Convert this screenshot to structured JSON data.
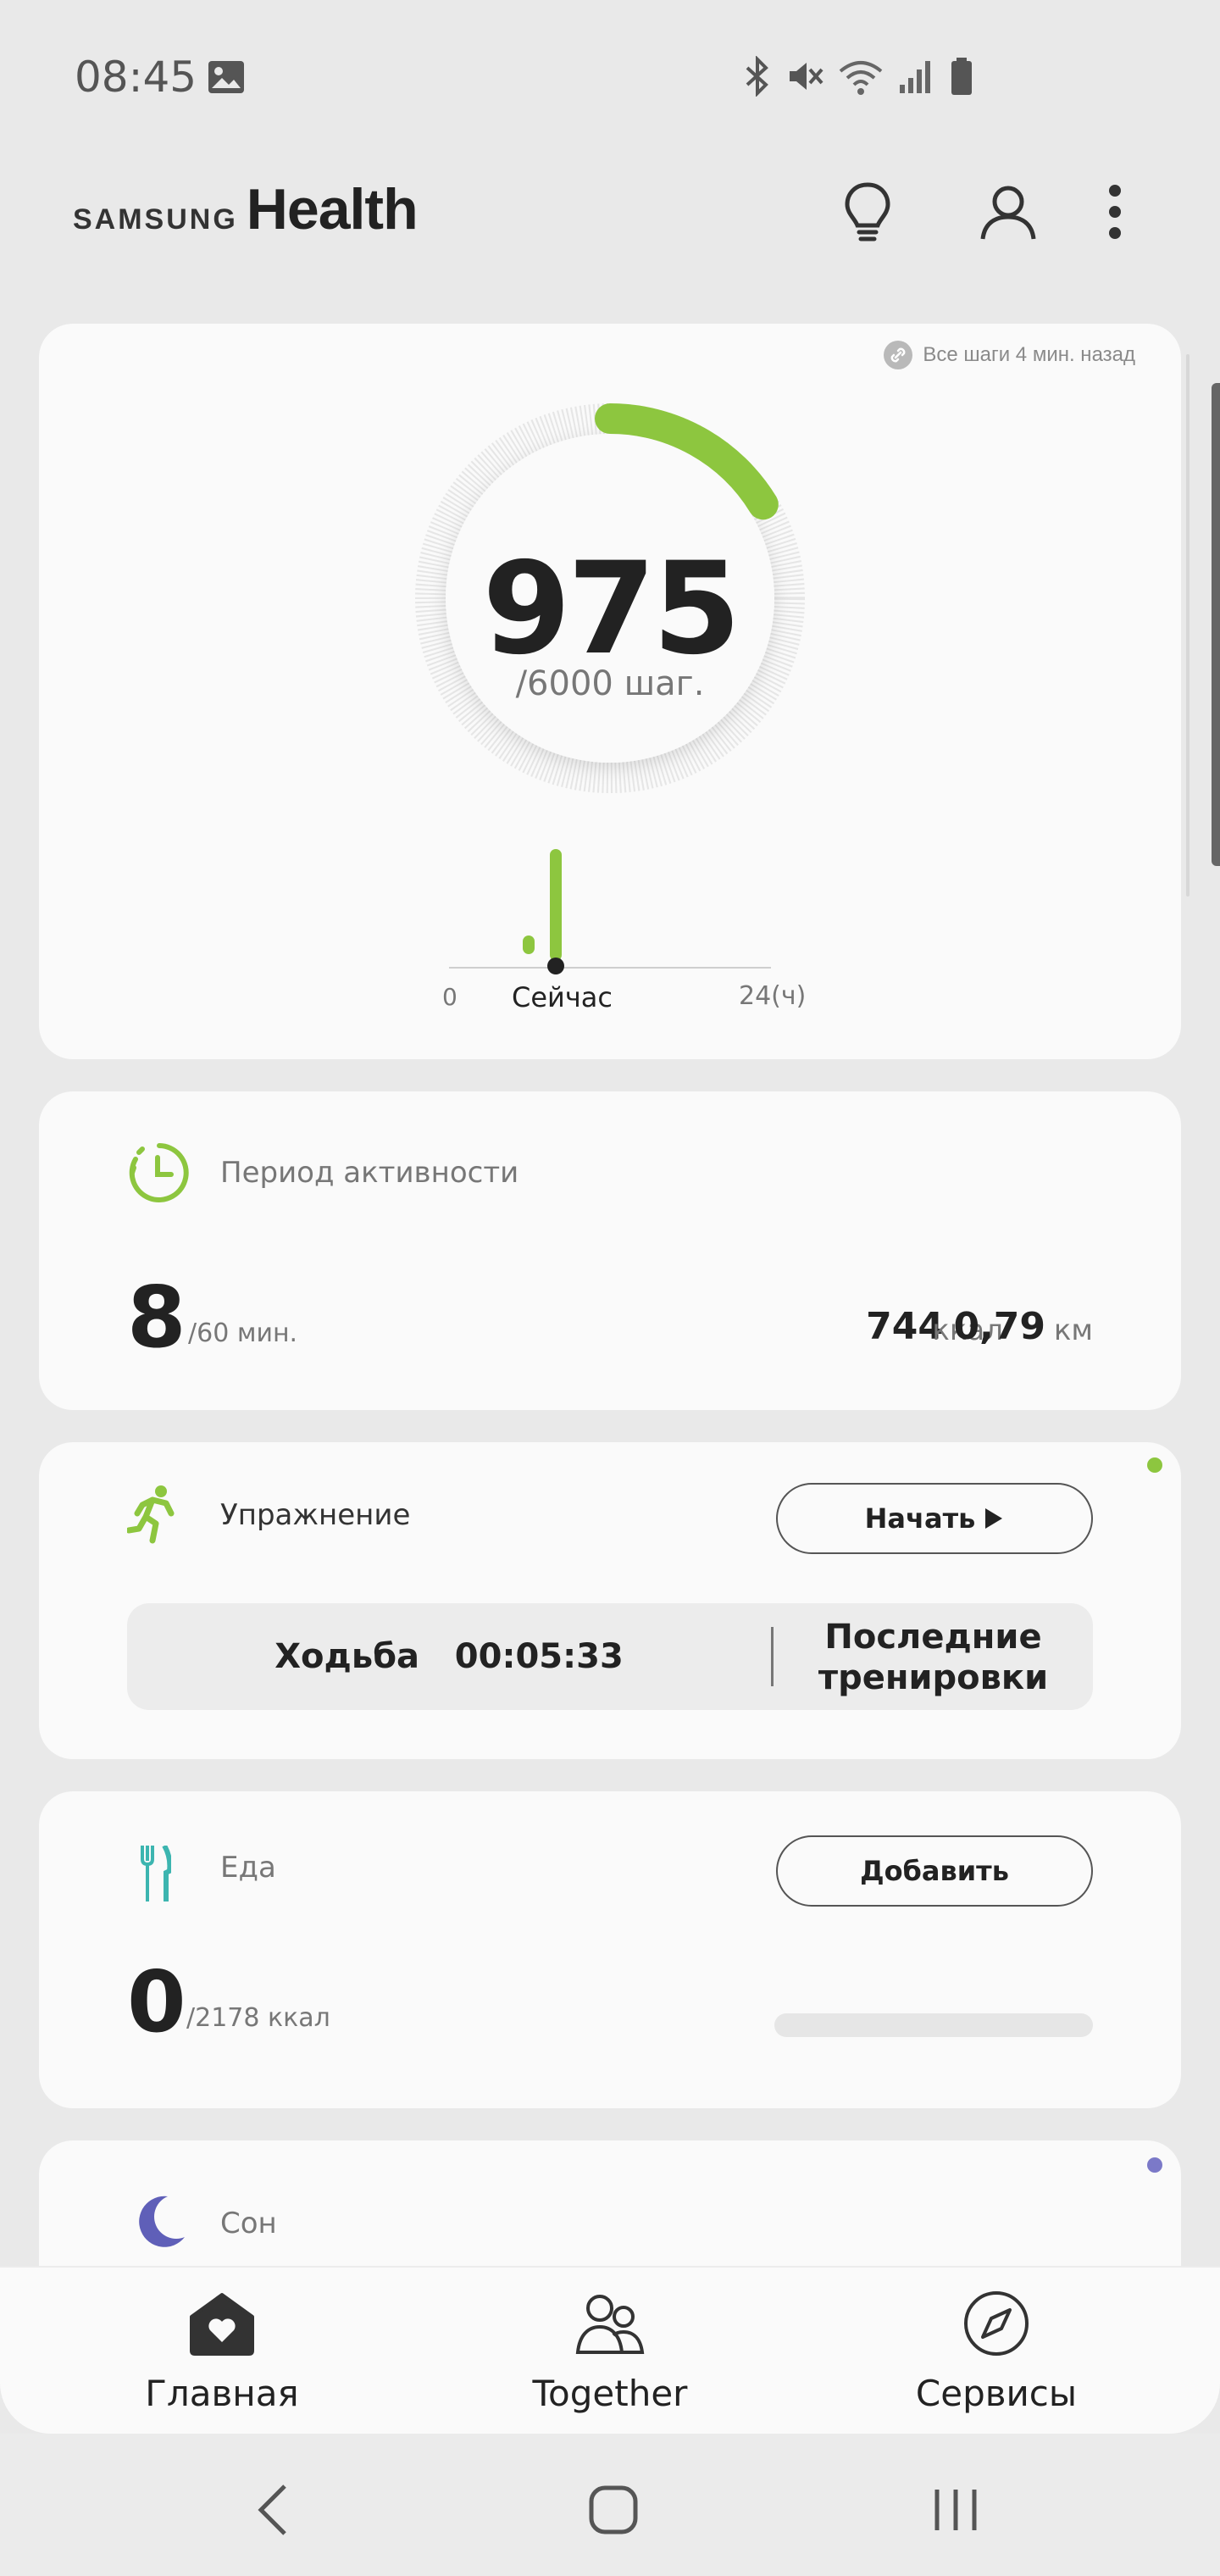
{
  "status_bar": {
    "time": "08:45"
  },
  "header": {
    "brand_samsung": "SAMSUNG",
    "brand_health": "Health"
  },
  "steps": {
    "sync_note": "Все шаги 4 мин. назад",
    "value": "975",
    "goal": "/6000 шаг.",
    "progress_fraction": 0.1625,
    "timeline": {
      "start": "0",
      "now": "Сейчас",
      "end": "24(ч)"
    }
  },
  "active_period": {
    "title": "Период активности",
    "value": "8",
    "goal": "/60 мин.",
    "kcal": "744",
    "kcal_unit": "ккал",
    "distance": "0,79",
    "distance_unit": "км"
  },
  "exercise": {
    "title": "Упражнение",
    "start_label": "Начать",
    "last_activity": "Ходьба   00:05:33",
    "recent_workouts": "Последние тренировки"
  },
  "food": {
    "title": "Еда",
    "add_label": "Добавить",
    "value": "0",
    "goal": "/2178 ккал"
  },
  "sleep": {
    "title": "Сон"
  },
  "bottom_nav": {
    "items": [
      {
        "label": "Главная"
      },
      {
        "label": "Together"
      },
      {
        "label": "Сервисы"
      }
    ]
  },
  "colors": {
    "accent_green": "#8dc63f",
    "sleep_purple": "#5f5fb8",
    "food_teal": "#3cb5b0"
  }
}
